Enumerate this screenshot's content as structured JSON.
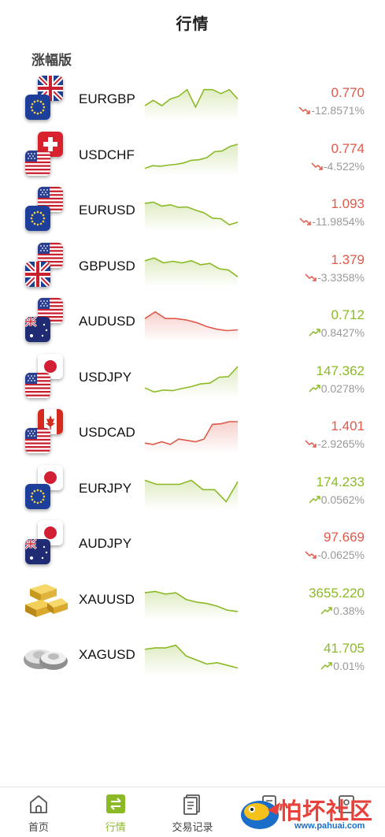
{
  "header": {
    "title": "行情"
  },
  "section": {
    "title": "涨幅版"
  },
  "colors": {
    "up": "#8cba27",
    "down": "#e0594a",
    "muted": "#999999"
  },
  "quotes": [
    {
      "symbol": "EURGBP",
      "price": "0.770",
      "change": "-12.8571%",
      "dir": "down",
      "chart": "up",
      "flags": [
        "uk",
        "eu"
      ],
      "spark": [
        0.35,
        0.55,
        0.35,
        0.6,
        0.7,
        0.95,
        0.3,
        0.95,
        0.95,
        0.8,
        0.95,
        0.6
      ]
    },
    {
      "symbol": "USDCHF",
      "price": "0.774",
      "change": "-4.522%",
      "dir": "down",
      "chart": "up",
      "flags": [
        "ch",
        "us"
      ],
      "spark": [
        0.1,
        0.2,
        0.18,
        0.22,
        0.25,
        0.3,
        0.4,
        0.42,
        0.5,
        0.72,
        0.75,
        0.92,
        1.0
      ]
    },
    {
      "symbol": "EURUSD",
      "price": "1.093",
      "change": "-11.9854%",
      "dir": "down",
      "chart": "up",
      "flags": [
        "us",
        "eu"
      ],
      "spark": [
        0.85,
        0.9,
        0.75,
        0.8,
        0.7,
        0.72,
        0.6,
        0.5,
        0.3,
        0.28,
        0.05,
        0.15
      ]
    },
    {
      "symbol": "GBPUSD",
      "price": "1.379",
      "change": "-3.3358%",
      "dir": "down",
      "chart": "up",
      "flags": [
        "us",
        "uk"
      ],
      "spark": [
        0.8,
        0.9,
        0.72,
        0.78,
        0.72,
        0.8,
        0.65,
        0.7,
        0.5,
        0.45,
        0.2
      ]
    },
    {
      "symbol": "AUDUSD",
      "price": "0.712",
      "change": "0.8427%",
      "dir": "up",
      "chart": "down",
      "flags": [
        "us",
        "au"
      ],
      "spark": [
        0.7,
        0.95,
        0.7,
        0.7,
        0.65,
        0.55,
        0.4,
        0.3,
        0.25,
        0.28
      ]
    },
    {
      "symbol": "USDJPY",
      "price": "147.362",
      "change": "0.0278%",
      "dir": "up",
      "chart": "up",
      "flags": [
        "jp",
        "us"
      ],
      "spark": [
        0.2,
        0.05,
        0.12,
        0.1,
        0.18,
        0.25,
        0.35,
        0.38,
        0.6,
        0.62,
        1.0
      ]
    },
    {
      "symbol": "USDCAD",
      "price": "1.401",
      "change": "-2.9265%",
      "dir": "down",
      "chart": "down",
      "flags": [
        "ca",
        "us"
      ],
      "spark": [
        0.2,
        0.15,
        0.25,
        0.15,
        0.35,
        0.3,
        0.25,
        0.35,
        0.9,
        0.92,
        1.0,
        1.0
      ]
    },
    {
      "symbol": "EURJPY",
      "price": "174.233",
      "change": "0.0562%",
      "dir": "up",
      "chart": "up",
      "flags": [
        "jp",
        "eu"
      ],
      "spark": [
        0.9,
        0.75,
        0.75,
        0.75,
        0.9,
        0.55,
        0.55,
        0.1,
        0.85
      ]
    },
    {
      "symbol": "AUDJPY",
      "price": "97.669",
      "change": "-0.0625%",
      "dir": "down",
      "chart": "none",
      "flags": [
        "jp",
        "au"
      ],
      "spark": []
    },
    {
      "symbol": "XAUUSD",
      "price": "3655.220",
      "change": "0.38%",
      "dir": "up",
      "chart": "up",
      "flags": [
        "gold"
      ],
      "spark": [
        0.85,
        0.9,
        0.8,
        0.85,
        0.6,
        0.5,
        0.45,
        0.35,
        0.2,
        0.15
      ]
    },
    {
      "symbol": "XAGUSD",
      "price": "41.705",
      "change": "0.01%",
      "dir": "up",
      "chart": "up",
      "flags": [
        "silver"
      ],
      "spark": [
        0.8,
        0.85,
        0.85,
        0.95,
        0.55,
        0.4,
        0.25,
        0.3,
        0.2,
        0.1
      ]
    }
  ],
  "tabs": [
    {
      "label": "首页",
      "icon": "home-icon",
      "active": false
    },
    {
      "label": "行情",
      "icon": "exchange-icon",
      "active": true
    },
    {
      "label": "交易记录",
      "icon": "document-icon",
      "active": false
    },
    {
      "label": "",
      "icon": "wallet-icon",
      "active": false
    },
    {
      "label": "",
      "icon": "user-icon",
      "active": false
    }
  ],
  "watermark": {
    "text": "怕坏社区",
    "url": "www.pahuai.com"
  }
}
